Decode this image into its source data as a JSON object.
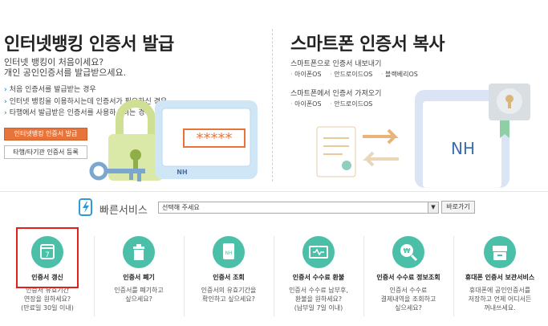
{
  "left": {
    "title": "인터넷뱅킹 인증서 발급",
    "sub1": "인터넷 뱅킹이 처음이세요?",
    "sub2": "개인 공인인증서를 발급받으세요.",
    "bullets": [
      "처음 인증서를 발급받는 경우",
      "인터넷 뱅킹을 이용하시는데 인증서가 필요하신 경우",
      "타행에서 발급받은 인증서를 사용하시려는 경우"
    ],
    "issue_button": "인터넷뱅킹 인증서 발급",
    "register_button": "타행/타기관 인증서 등록",
    "password_mask": "*****",
    "brand": "NH"
  },
  "right": {
    "title": "스마트폰 인증서 복사",
    "export_label": "스마트폰으로 인증서 내보내기",
    "export_links": [
      "아이폰OS",
      "안드로이드OS",
      "블랙베리OS"
    ],
    "import_label": "스마트폰에서 인증서 가져오기",
    "import_links": [
      "아이폰OS",
      "안드로이드OS"
    ],
    "brand": "NH"
  },
  "quick": {
    "label": "빠른서비스",
    "select_value": "선택해 주세요",
    "go_button": "바로가기"
  },
  "services": [
    {
      "title": "인증서 갱신",
      "desc": [
        "인증서 유효기간",
        "연장을 원하세요?",
        "(만료일 30일 이내)"
      ],
      "icon": "calendar-icon",
      "icon_text": "7"
    },
    {
      "title": "인증서 폐기",
      "desc": [
        "인증서를 폐기하고",
        "싶으세요?"
      ],
      "icon": "trash-icon"
    },
    {
      "title": "인증서 조회",
      "desc": [
        "인증서의 유효기간을",
        "확인하고 싶으세요?"
      ],
      "icon": "certificate-doc-icon",
      "icon_text": "NH"
    },
    {
      "title": "인증서 수수료 환불",
      "desc": [
        "인증서 수수료 납부후,",
        "환불을 원하세요?",
        "(납부일 7일 이내)"
      ],
      "icon": "refund-icon"
    },
    {
      "title": "인증서 수수료 정보조회",
      "desc": [
        "인증서 수수료",
        "결제내역을 조회하고",
        "싶으세요?"
      ],
      "icon": "search-won-icon",
      "icon_text": "₩"
    },
    {
      "title": "휴대폰 인증서 보관서비스",
      "desc": [
        "휴대폰에 공인인증서를",
        "저장하고 언제 어디서든",
        "꺼내쓰세요."
      ],
      "icon": "storage-box-icon"
    }
  ],
  "colors": {
    "accent": "#4cbfa8",
    "orange": "#e9743a",
    "highlight": "#e0201b"
  }
}
